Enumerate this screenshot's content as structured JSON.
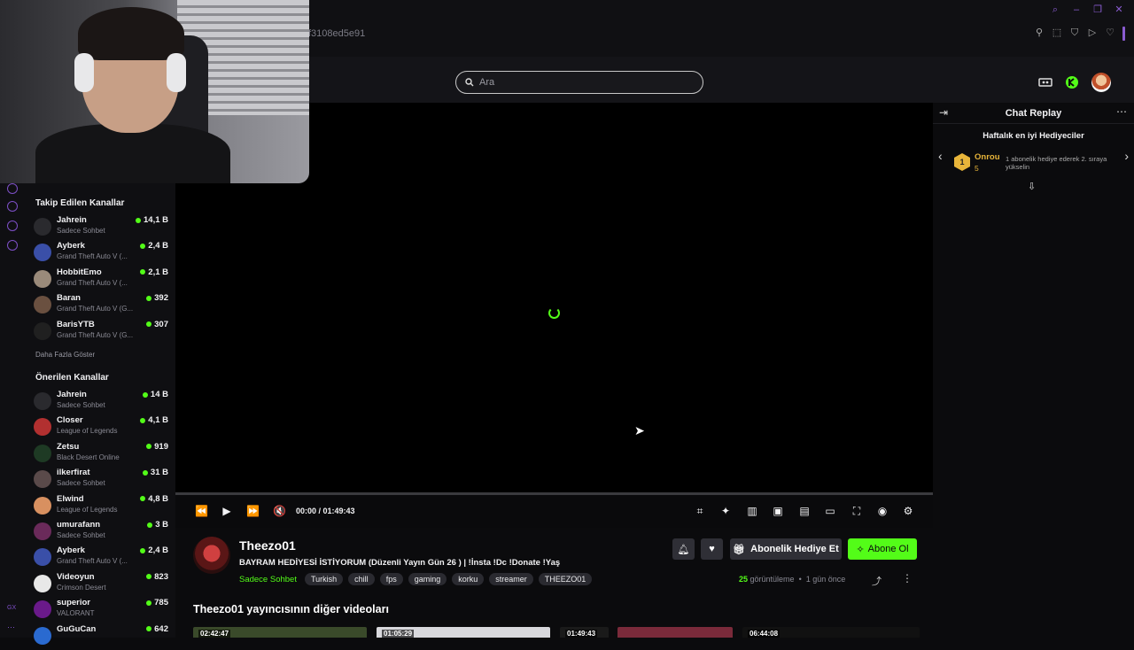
{
  "browser": {
    "url_fragment": "f3108ed5e91"
  },
  "search": {
    "placeholder": "Ara"
  },
  "sidebar": {
    "followed_title": "Takip Edilen Kanallar",
    "followed": [
      {
        "name": "Jahrein",
        "game": "Sadece Sohbet",
        "viewers": "14,1 B",
        "color": "#2a2a2e"
      },
      {
        "name": "Ayberk",
        "game": "Grand Theft Auto V (...",
        "viewers": "2,4 B",
        "color": "#3a4fa8"
      },
      {
        "name": "HobbitEmo",
        "game": "Grand Theft Auto V (...",
        "viewers": "2,1 B",
        "color": "#9a8a7a"
      },
      {
        "name": "Baran",
        "game": "Grand Theft Auto V (G...",
        "viewers": "392",
        "color": "#6a5040"
      },
      {
        "name": "BarisYTB",
        "game": "Grand Theft Auto V (G...",
        "viewers": "307",
        "color": "#202020"
      }
    ],
    "show_more": "Daha Fazla Göster",
    "recommended_title": "Önerilen Kanallar",
    "recommended": [
      {
        "name": "Jahrein",
        "game": "Sadece Sohbet",
        "viewers": "14 B",
        "color": "#2a2a2e"
      },
      {
        "name": "Closer",
        "game": "League of Legends",
        "viewers": "4,1 B",
        "color": "#b23030"
      },
      {
        "name": "Zetsu",
        "game": "Black Desert Online",
        "viewers": "919",
        "color": "#1e3a24"
      },
      {
        "name": "ilkerfirat",
        "game": "Sadece Sohbet",
        "viewers": "31 B",
        "color": "#5a4a4a"
      },
      {
        "name": "Elwind",
        "game": "League of Legends",
        "viewers": "4,8 B",
        "color": "#d89060"
      },
      {
        "name": "umurafann",
        "game": "Sadece Sohbet",
        "viewers": "3 B",
        "color": "#6a2a5a"
      },
      {
        "name": "Ayberk",
        "game": "Grand Theft Auto V (...",
        "viewers": "2,4 B",
        "color": "#3a4fa8"
      },
      {
        "name": "Videoyun",
        "game": "Crimson Desert",
        "viewers": "823",
        "color": "#e8e8e8"
      },
      {
        "name": "superior",
        "game": "VALORANT",
        "viewers": "785",
        "color": "#6a1a8a"
      },
      {
        "name": "GuGuCan",
        "game": "",
        "viewers": "642",
        "color": "#2a6ad0"
      }
    ]
  },
  "player": {
    "time": "00:00 / 01:49:43"
  },
  "channel": {
    "name": "Theezo01",
    "title": "BAYRAM HEDİYESİ İSTİYORUM  (Düzenli Yayın Gün 26 )  | !İnsta !Dc !Donate !Yaş",
    "category": "Sadece Sohbet",
    "tags": [
      "Turkish",
      "chill",
      "fps",
      "gaming",
      "korku",
      "streamer",
      "THEEZO01"
    ],
    "gift_label": "Abonelik Hediye Et",
    "subscribe_label": "Abone Ol",
    "views_count": "25",
    "views_label": "görüntüleme",
    "ago": "1 gün önce",
    "other_videos_title": "Theezo01 yayıncısının diğer videoları",
    "thumbs": [
      {
        "time": "02:42:47",
        "color": "#3a4a2a"
      },
      {
        "time": "01:05:29",
        "color": "#d8d8dc"
      },
      {
        "time": "01:49:43",
        "color": "#1a1a1a"
      },
      {
        "time": "",
        "color": "#7a2a3a"
      },
      {
        "time": "06:44:08",
        "color": "#111"
      }
    ]
  },
  "chat": {
    "title": "Chat Replay",
    "gifters_title": "Haftalık en iyi Hediyeciler",
    "gifter_rank": "1",
    "gifter_name": "Onrou",
    "gifter_count": "5",
    "gifter_note": "1 abonelik hediye ederek 2. sıraya yükselin"
  },
  "colors": {
    "accent": "#53fc18",
    "browser_accent": "#8a5cd1"
  }
}
